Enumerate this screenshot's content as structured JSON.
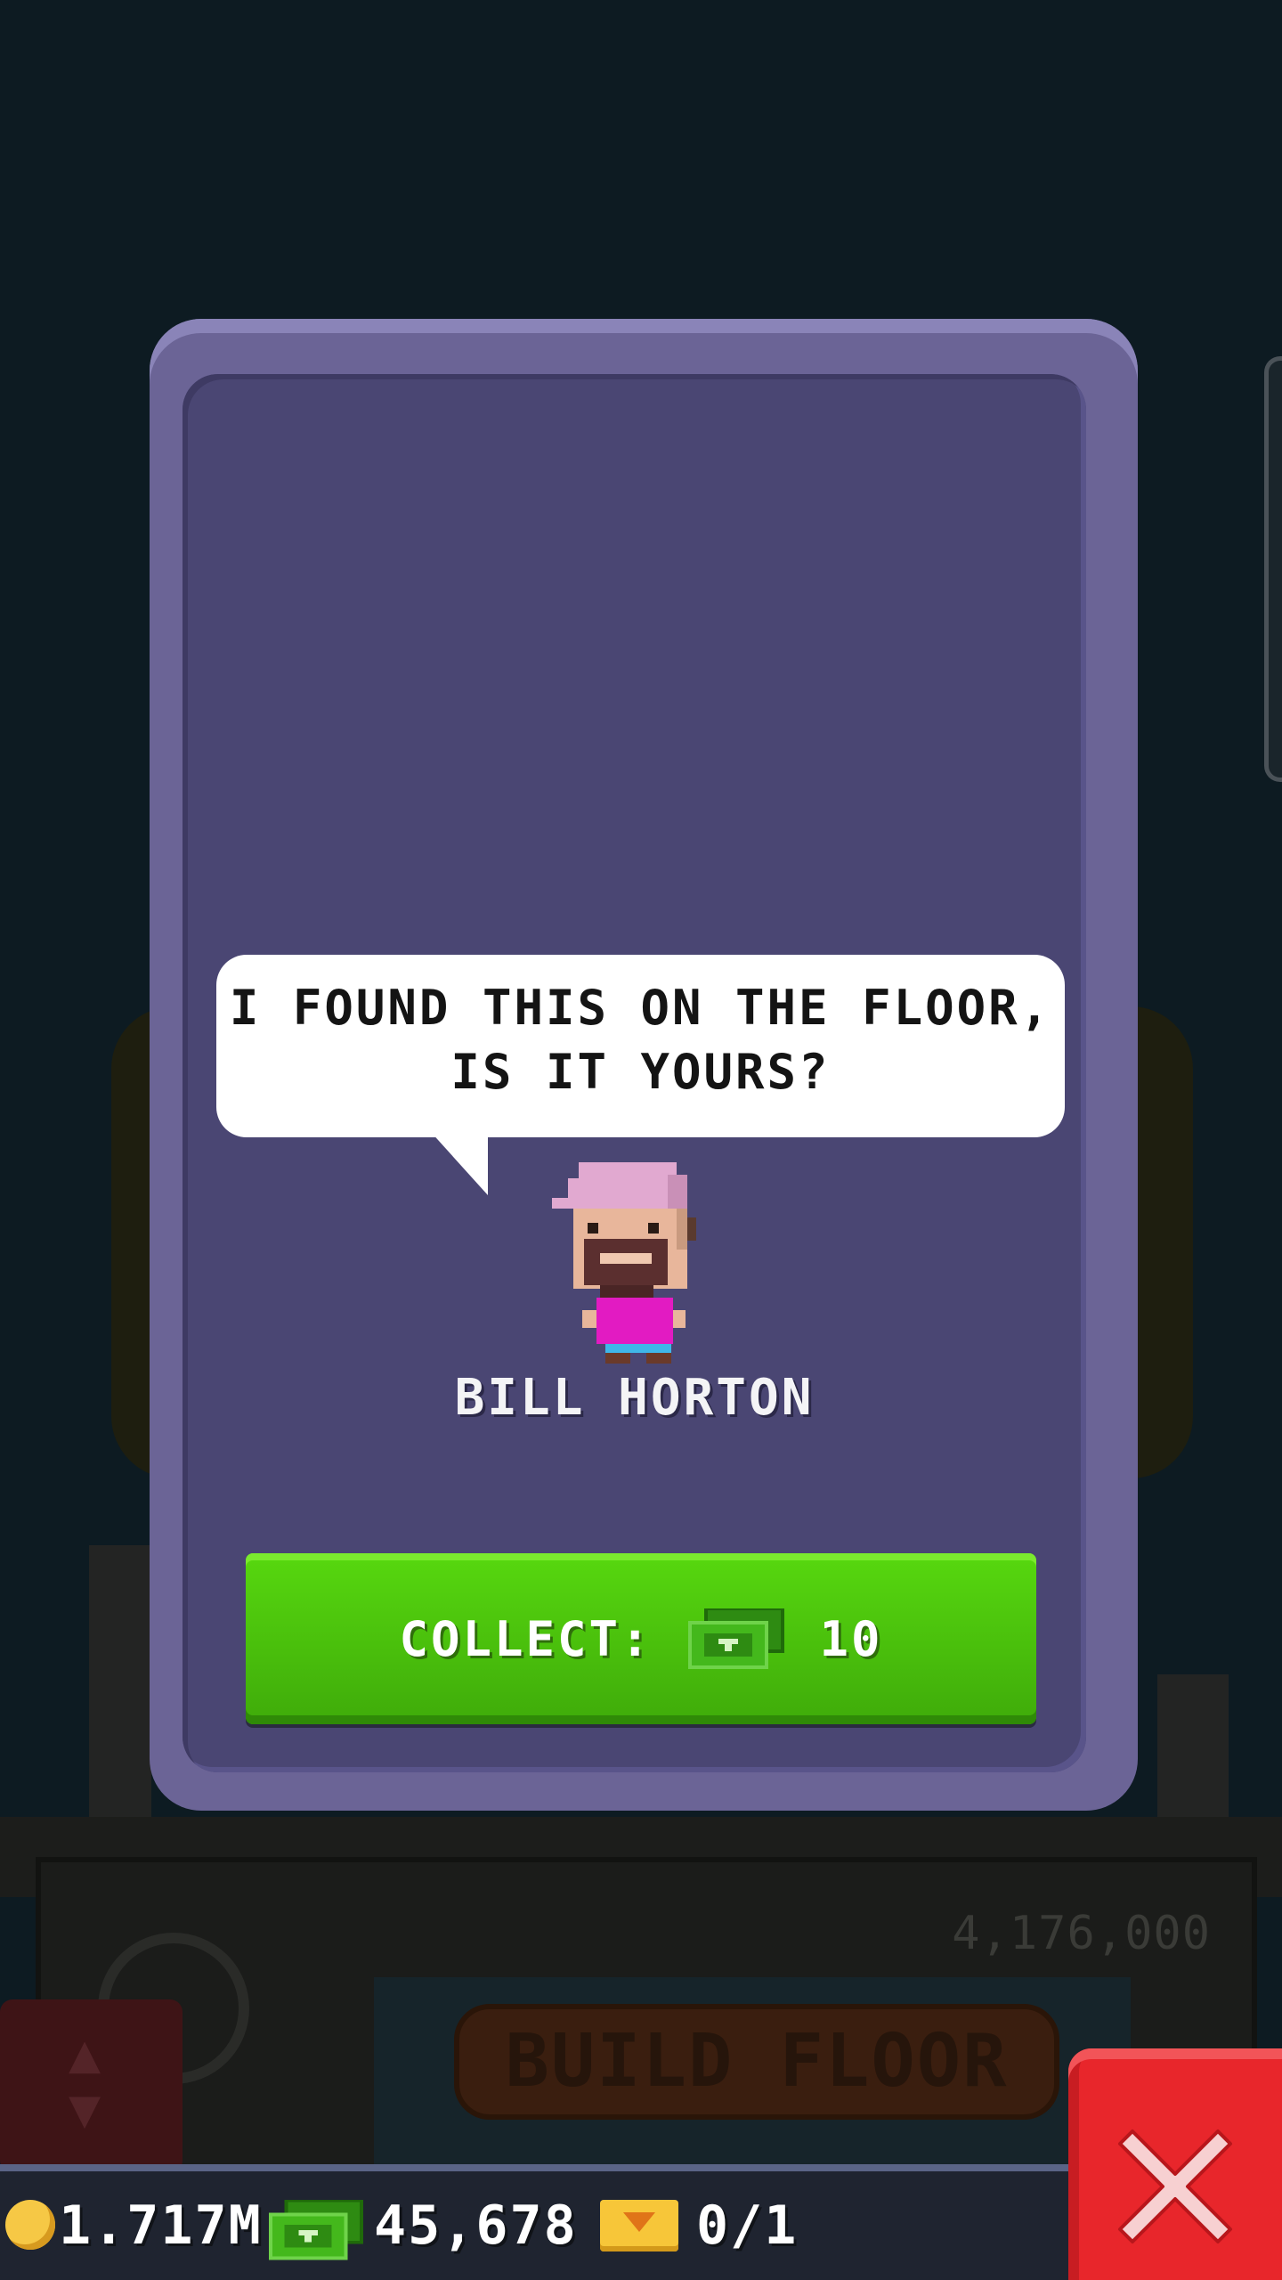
{
  "background": {
    "building_price": "4,176,000",
    "build_floor_label": "BUILD FLOOR"
  },
  "dialog": {
    "speech": "I FOUND THIS ON THE FLOOR, IS IT YOURS?",
    "character_name": "BILL HORTON",
    "collect_button": {
      "label": "COLLECT:",
      "amount": "10",
      "icon": "bux-icon"
    }
  },
  "currency_bar": {
    "coins": "1.717M",
    "bux": "45,678",
    "tickets": "0/1"
  },
  "colors": {
    "card_border": "#6b6496",
    "card_fill": "#4a4673",
    "collect_green": "#4cc20d",
    "close_red": "#e8262b"
  }
}
